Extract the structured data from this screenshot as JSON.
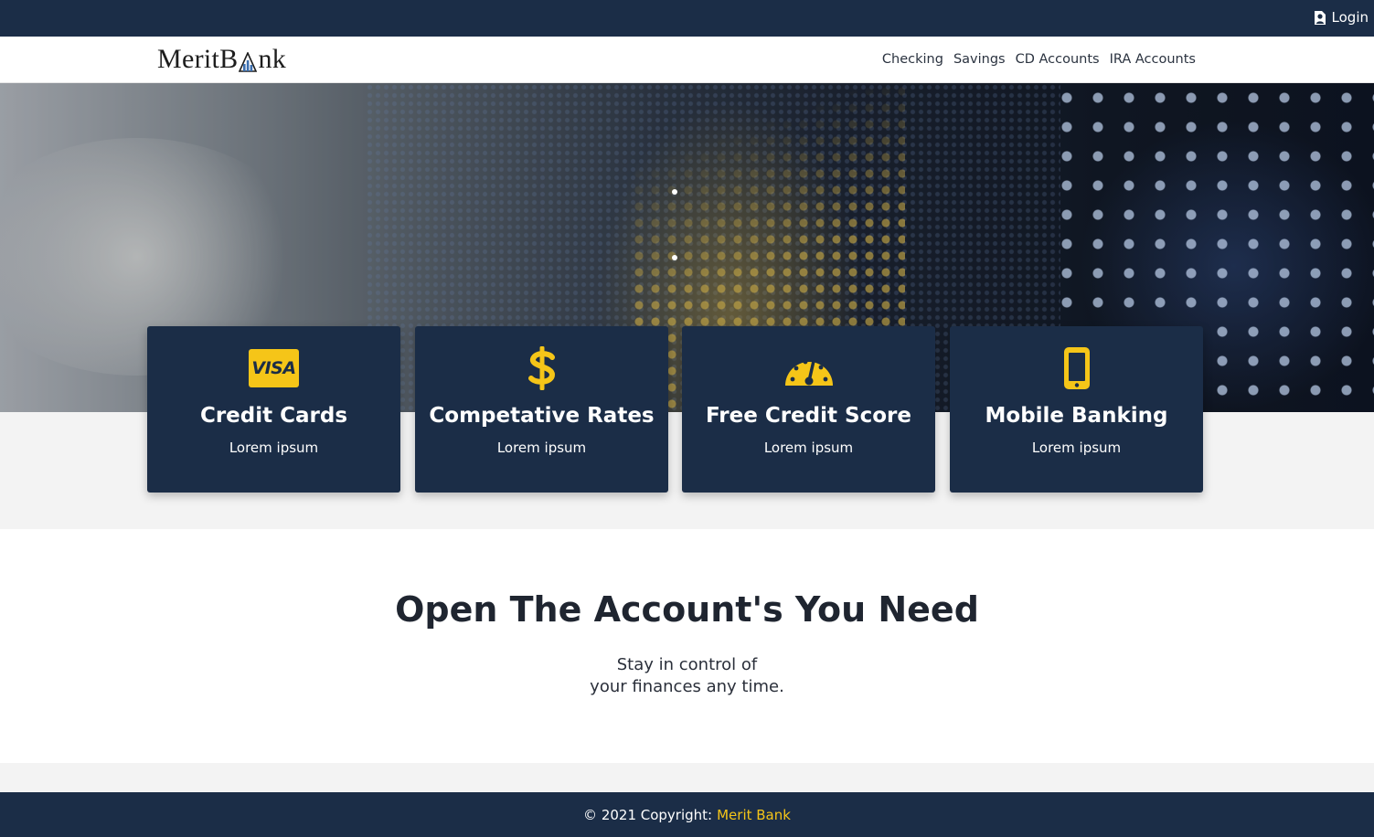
{
  "topbar": {
    "login_label": "Login"
  },
  "brand": {
    "logo_text_left": "MeritB",
    "logo_text_right": "nk"
  },
  "nav": {
    "items": [
      "Checking",
      "Savings",
      "CD Accounts",
      "IRA Accounts"
    ]
  },
  "features": [
    {
      "icon": "visa-card-icon",
      "icon_text": "VISA",
      "title": "Credit Cards",
      "subtitle": "Lorem ipsum"
    },
    {
      "icon": "dollar-sign-icon",
      "title": "Competative Rates",
      "subtitle": "Lorem ipsum"
    },
    {
      "icon": "speedometer-icon",
      "title": "Free Credit Score",
      "subtitle": "Lorem ipsum"
    },
    {
      "icon": "mobile-phone-icon",
      "title": "Mobile Banking",
      "subtitle": "Lorem ipsum"
    }
  ],
  "accounts": {
    "headline": "Open The Account's You Need",
    "tagline_line1": "Stay in control of",
    "tagline_line2": "your finances any time."
  },
  "footer": {
    "copyright": "© 2021 Copyright:",
    "brand_link": "Merit Bank"
  },
  "colors": {
    "navy": "#1b2d47",
    "accent_yellow": "#f5c518",
    "light_gray": "#f3f3f3"
  }
}
